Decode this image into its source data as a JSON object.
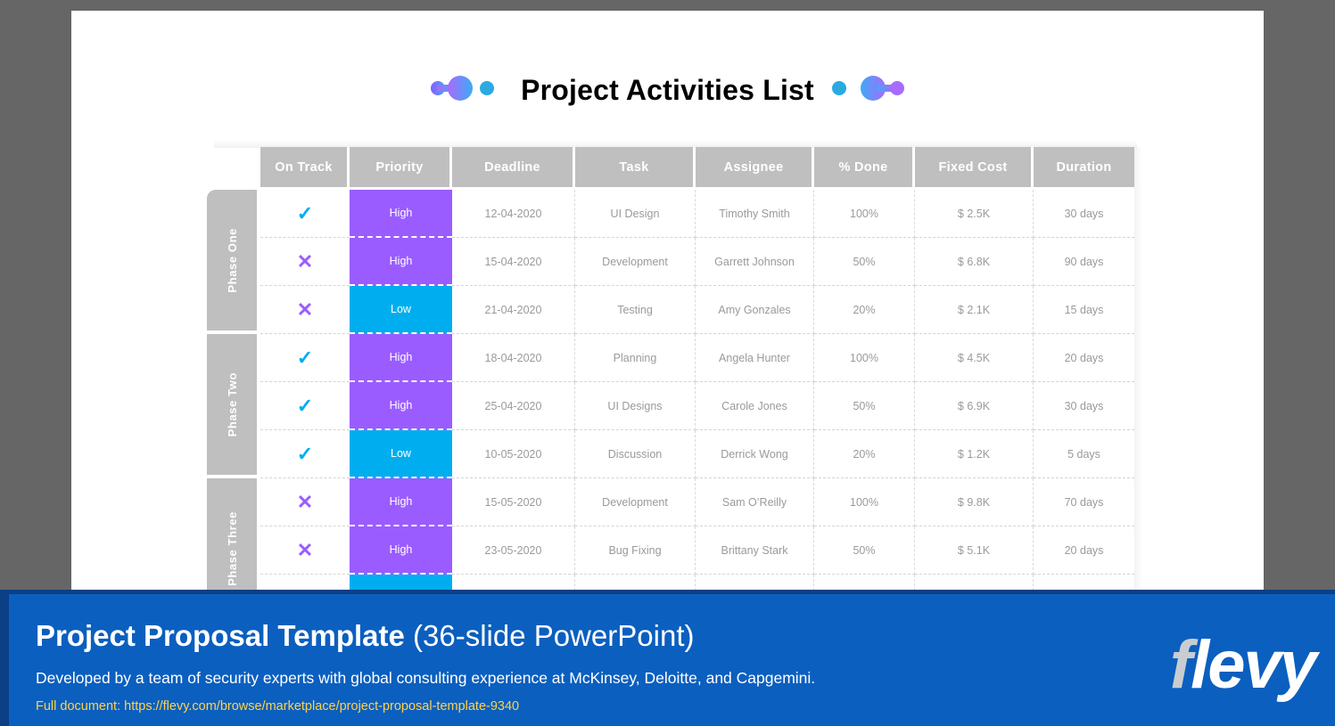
{
  "slide": {
    "title": "Project Activities List",
    "decoration_left": "gradient-dots",
    "decoration_right": "gradient-dots",
    "colors": {
      "priority_high": "#9B5CFF",
      "priority_low": "#00AEEF",
      "header_gray": "#BFBFBF",
      "check_cyan": "#00AEEF",
      "cross_purple": "#9B5CFF",
      "banner_blue": "#0B5FBF",
      "banner_border": "#0B3F86",
      "link_yellow": "#FFD24A",
      "page_background": "#666666"
    }
  },
  "table": {
    "phase_header": "",
    "columns": [
      "On Track",
      "Priority",
      "Deadline",
      "Task",
      "Assignee",
      "% Done",
      "Fixed Cost",
      "Duration"
    ],
    "phases": [
      {
        "label": "Phase One",
        "rows": 3
      },
      {
        "label": "Phase Two",
        "rows": 3
      },
      {
        "label": "Phase Three",
        "rows": 3
      }
    ],
    "rows": [
      {
        "on_track": "check",
        "on_track_symbol": "✓",
        "priority": "High",
        "priority_level": "high",
        "deadline": "12-04-2020",
        "task": "UI Design",
        "assignee": "Timothy Smith",
        "percent_done": "100%",
        "fixed_cost": "$ 2.5K",
        "duration": "30 days"
      },
      {
        "on_track": "cross",
        "on_track_symbol": "✕",
        "priority": "High",
        "priority_level": "high",
        "deadline": "15-04-2020",
        "task": "Development",
        "assignee": "Garrett Johnson",
        "percent_done": "50%",
        "fixed_cost": "$ 6.8K",
        "duration": "90 days"
      },
      {
        "on_track": "cross",
        "on_track_symbol": "✕",
        "priority": "Low",
        "priority_level": "low",
        "deadline": "21-04-2020",
        "task": "Testing",
        "assignee": "Amy Gonzales",
        "percent_done": "20%",
        "fixed_cost": "$ 2.1K",
        "duration": "15 days"
      },
      {
        "on_track": "check",
        "on_track_symbol": "✓",
        "priority": "High",
        "priority_level": "high",
        "deadline": "18-04-2020",
        "task": "Planning",
        "assignee": "Angela Hunter",
        "percent_done": "100%",
        "fixed_cost": "$ 4.5K",
        "duration": "20 days"
      },
      {
        "on_track": "check",
        "on_track_symbol": "✓",
        "priority": "High",
        "priority_level": "high",
        "deadline": "25-04-2020",
        "task": "UI Designs",
        "assignee": "Carole Jones",
        "percent_done": "50%",
        "fixed_cost": "$ 6.9K",
        "duration": "30 days"
      },
      {
        "on_track": "check",
        "on_track_symbol": "✓",
        "priority": "Low",
        "priority_level": "low",
        "deadline": "10-05-2020",
        "task": "Discussion",
        "assignee": "Derrick Wong",
        "percent_done": "20%",
        "fixed_cost": "$ 1.2K",
        "duration": "5 days"
      },
      {
        "on_track": "cross",
        "on_track_symbol": "✕",
        "priority": "High",
        "priority_level": "high",
        "deadline": "15-05-2020",
        "task": "Development",
        "assignee": "Sam O’Reilly",
        "percent_done": "100%",
        "fixed_cost": "$ 9.8K",
        "duration": "70 days"
      },
      {
        "on_track": "cross",
        "on_track_symbol": "✕",
        "priority": "High",
        "priority_level": "high",
        "deadline": "23-05-2020",
        "task": "Bug Fixing",
        "assignee": "Brittany Stark",
        "percent_done": "50%",
        "fixed_cost": "$ 5.1K",
        "duration": "20 days"
      },
      {
        "on_track": "",
        "on_track_symbol": "",
        "priority": "",
        "priority_level": "low",
        "deadline": "",
        "task": "",
        "assignee": "",
        "percent_done": "",
        "fixed_cost": "",
        "duration": ""
      }
    ]
  },
  "footer": {
    "title_bold": "Project Proposal Template",
    "title_light": " (36-slide PowerPoint)",
    "subtitle": "Developed by a team of security experts with global consulting experience at McKinsey, Deloitte, and Capgemini.",
    "link": "Full document: https://flevy.com/browse/marketplace/project-proposal-template-9340",
    "logo_first": "f",
    "logo_rest": "levy"
  }
}
